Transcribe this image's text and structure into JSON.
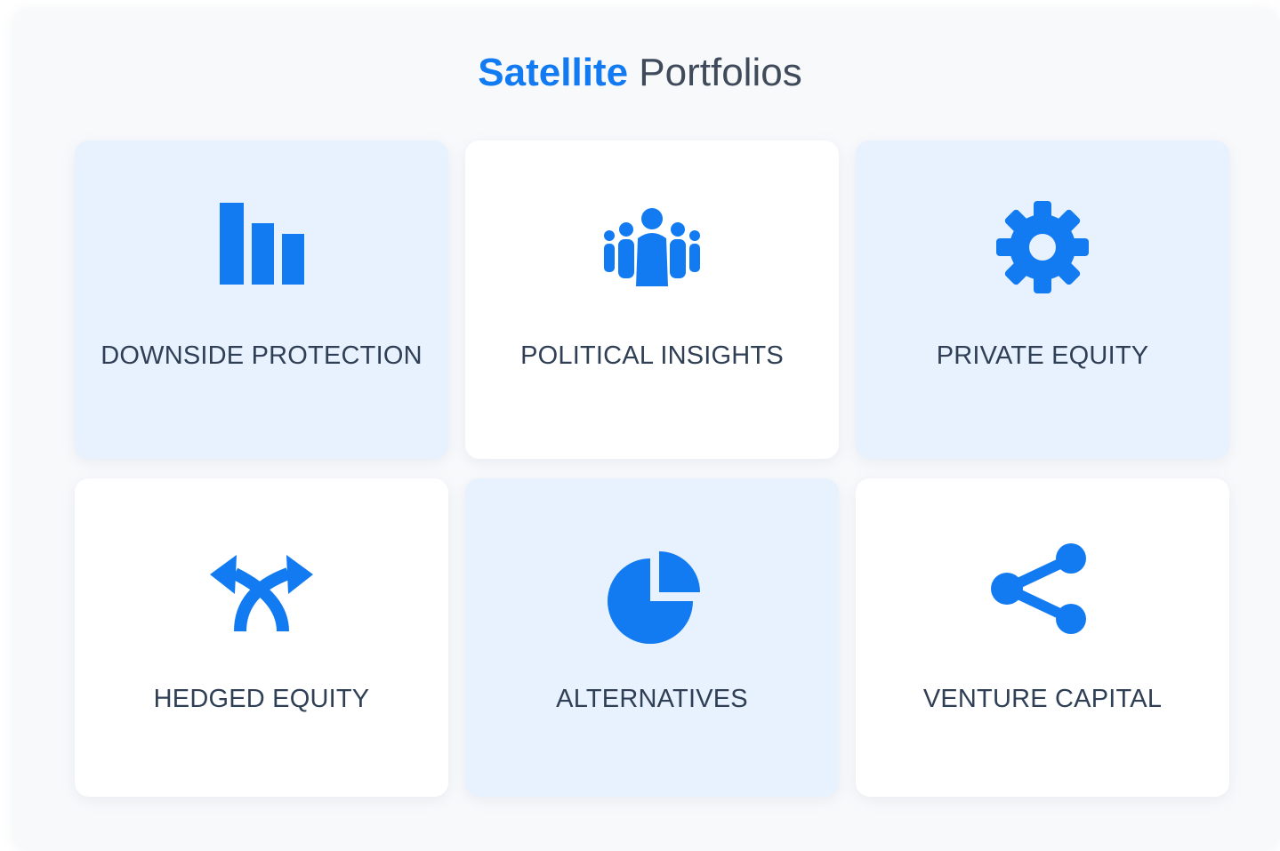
{
  "header": {
    "title_accent": "Satellite",
    "title_rest": "Portfolios"
  },
  "colors": {
    "accent": "#137bf2",
    "card_blue": "#e8f1fe",
    "card_white": "#ffffff",
    "label_text": "#2f3f55"
  },
  "cards": [
    {
      "label": "DOWNSIDE PROTECTION",
      "icon": "bar-chart-icon",
      "tint": "blue"
    },
    {
      "label": "POLITICAL INSIGHTS",
      "icon": "people-group-icon",
      "tint": "white"
    },
    {
      "label": "PRIVATE EQUITY",
      "icon": "gear-icon",
      "tint": "blue"
    },
    {
      "label": "HEDGED EQUITY",
      "icon": "split-arrows-icon",
      "tint": "white"
    },
    {
      "label": "ALTERNATIVES",
      "icon": "pie-chart-icon",
      "tint": "blue"
    },
    {
      "label": "VENTURE CAPITAL",
      "icon": "share-icon",
      "tint": "white"
    }
  ]
}
